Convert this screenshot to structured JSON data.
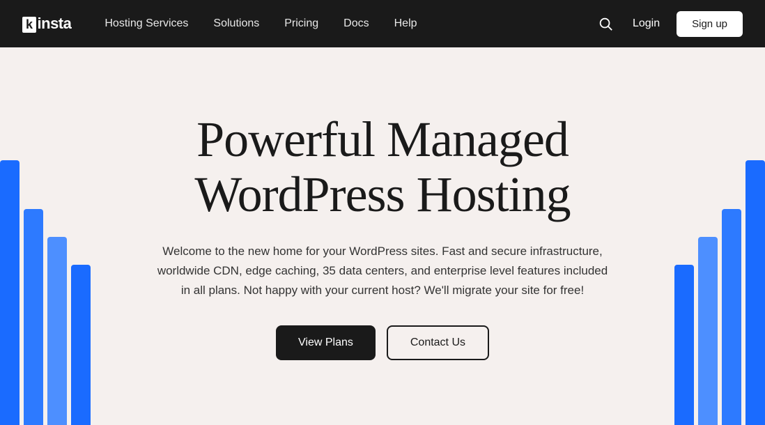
{
  "navbar": {
    "logo": "Kinsta",
    "nav_items": [
      {
        "label": "Hosting Services",
        "id": "hosting-services"
      },
      {
        "label": "Solutions",
        "id": "solutions"
      },
      {
        "label": "Pricing",
        "id": "pricing"
      },
      {
        "label": "Docs",
        "id": "docs"
      },
      {
        "label": "Help",
        "id": "help"
      }
    ],
    "login_label": "Login",
    "signup_label": "Sign up"
  },
  "hero": {
    "title": "Powerful Managed WordPress Hosting",
    "description": "Welcome to the new home for your WordPress sites. Fast and secure infrastructure, worldwide CDN, edge caching, 35 data centers, and enterprise level features included in all plans. Not happy with your current host? We'll migrate your site for free!",
    "cta_primary": "View Plans",
    "cta_secondary": "Contact Us"
  }
}
